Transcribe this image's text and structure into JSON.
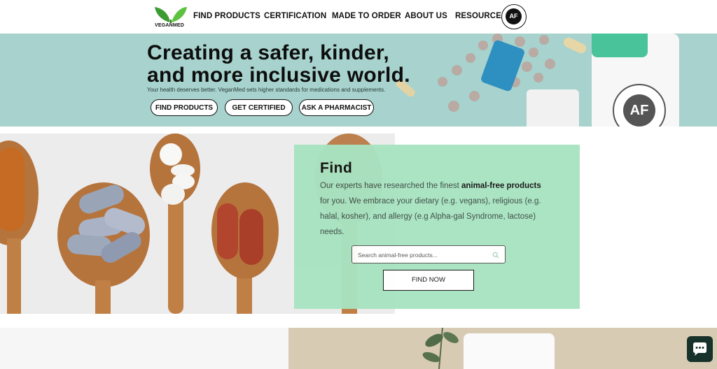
{
  "header": {
    "logo_text": "VEGANMED",
    "nav": [
      "FIND PRODUCTS",
      "CERTIFICATION",
      "MADE TO ORDER",
      "ABOUT US",
      "RESOURCES"
    ],
    "badge_text": "AF"
  },
  "hero": {
    "title_line1": "Creating a safer, kinder,",
    "title_line2": "and more inclusive world.",
    "subtitle": "Your health deserves better. VeganMed sets higher standards for medications and supplements.",
    "buttons": [
      "FIND PRODUCTS",
      "GET CERTIFIED",
      "ASK A PHARMACIST"
    ],
    "badge_text": "AF"
  },
  "find": {
    "title": "Find",
    "text_before": "Our experts have researched the finest ",
    "text_bold": "animal-free products",
    "text_after": " for you. We embrace your dietary (e.g. vegans), religious (e.g. halal, kosher), and allergy (e.g  Alpha-gal Syndrome, lactose) needs.",
    "search_placeholder": "Search animal-free products...",
    "button_label": "FIND NOW"
  },
  "colors": {
    "hero_bg": "#a7d2cd",
    "find_card_bg": "#a8e3c1",
    "logo_green": "#4caf3f",
    "chat_bg": "#17322a"
  }
}
